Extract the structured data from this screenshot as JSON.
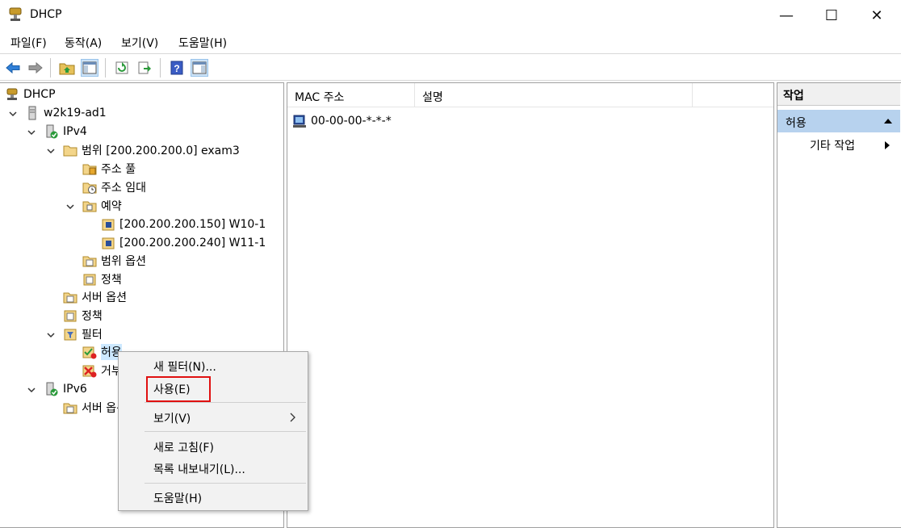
{
  "window": {
    "title": "DHCP",
    "minimize_glyph": "—",
    "maximize_glyph": "☐",
    "close_glyph": "✕"
  },
  "menubar": {
    "file": "파일(F)",
    "action": "동작(A)",
    "view": "보기(V)",
    "help": "도움말(H)"
  },
  "toolbar": {
    "icons": [
      "back-arrow-icon",
      "forward-arrow-icon",
      "up-folder-icon",
      "show-hide-console-tree-icon",
      "refresh-icon",
      "export-list-icon",
      "help-icon",
      "show-hide-action-pane-icon"
    ]
  },
  "tree": {
    "root": "DHCP",
    "server": "w2k19-ad1",
    "ipv4": "IPv4",
    "scope": "범위 [200.200.200.0] exam3",
    "address_pool": "주소 풀",
    "address_leases": "주소 임대",
    "reservations": "예약",
    "reservation_1": "[200.200.200.150] W10-1",
    "reservation_2": "[200.200.200.240] W11-1",
    "scope_options": "범위 옵션",
    "scope_policies": "정책",
    "server_options": "서버 옵션",
    "policies": "정책",
    "filters": "필터",
    "allow": "허용",
    "deny": "거부",
    "ipv6": "IPv6",
    "ipv6_server_options": "서버 옵션"
  },
  "list": {
    "columns": [
      "MAC 주소",
      "설명"
    ],
    "rows": [
      {
        "mac": "00-00-00-*-*-*",
        "description": ""
      }
    ]
  },
  "actions": {
    "title": "작업",
    "section": "허용",
    "more_actions": "기타 작업"
  },
  "context_menu": {
    "new_filter": "새 필터(N)...",
    "enable": "사용(E)",
    "view": "보기(V)",
    "refresh": "새로 고침(F)",
    "export_list": "목록 내보내기(L)...",
    "help": "도움말(H)"
  },
  "colors": {
    "selection": "#cce8ff",
    "action_section": "#b7d2ee",
    "highlight": "#e01010"
  }
}
